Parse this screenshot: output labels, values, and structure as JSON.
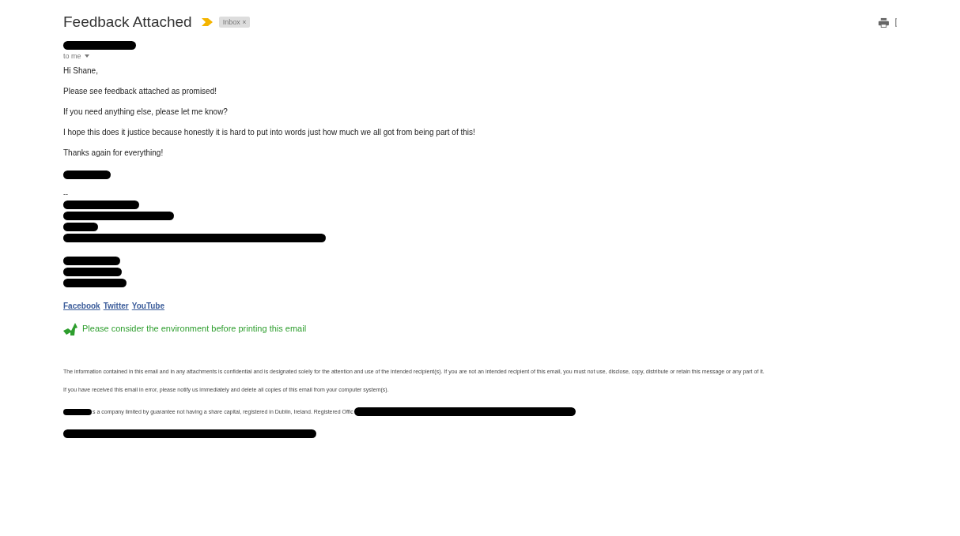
{
  "subject": "Feedback Attached",
  "important": true,
  "label": {
    "text": "Inbox",
    "close": "×"
  },
  "recipient": "to me",
  "body": [
    {
      "kind": "text",
      "text": "Hi Shane,"
    },
    {
      "kind": "text",
      "text": "Please see feedback attached as promised!"
    },
    {
      "kind": "text",
      "text": "If you need anything else, please let me know?"
    },
    {
      "kind": "text",
      "text": "I hope this does it justice because honestly it is hard to put into words just how much we all got from being part of this!"
    },
    {
      "kind": "text",
      "text": "Thanks again for everything!"
    }
  ],
  "signature_separator": "--",
  "links": [
    "Facebook",
    "Twitter",
    "YouTube"
  ],
  "eco_note": "Please consider the environment before printing this email",
  "disclaimer": [
    "The information contained in this email and in any attachments is confidential and is designated solely for the attention and use of the intended recipient(s).  If you are not an intended recipient of this email, you must not use, disclose, copy, distribute or retain this message or any part of it.",
    "If you have received this email in error, please notify us immediately and delete all copies of this email from your computer system(s)."
  ],
  "company_line": "s a company limited by guarantee not having a share capital, registered in Dublin, Ireland. Registered Offic"
}
